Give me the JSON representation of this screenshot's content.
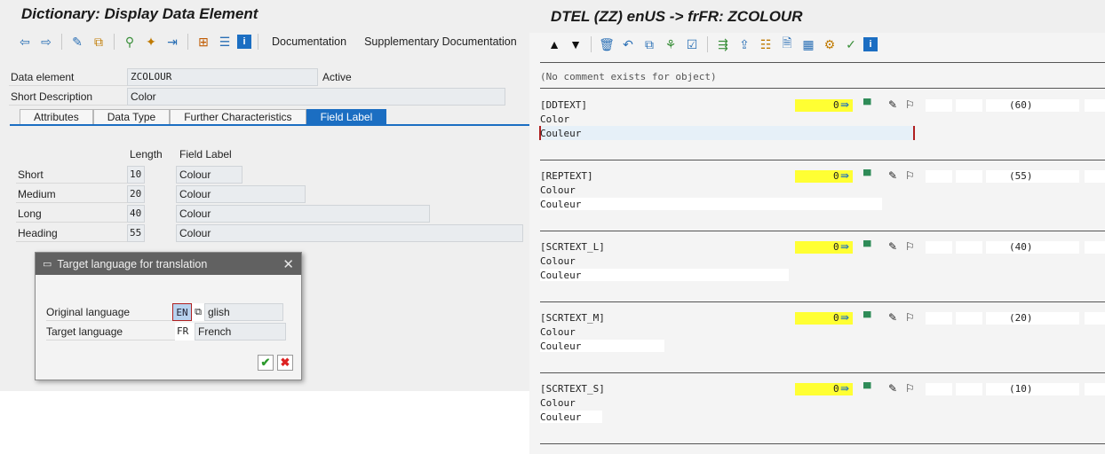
{
  "left_window": {
    "title": "Dictionary: Display Data Element",
    "toolbar": {
      "documentation": "Documentation",
      "supplementary": "Supplementary Documentation"
    },
    "data_element_label": "Data element",
    "data_element_value": "ZCOLOUR",
    "status": "Active",
    "short_desc_label": "Short Description",
    "short_desc_value": "Color",
    "tabs": [
      "Attributes",
      "Data Type",
      "Further Characteristics",
      "Field Label"
    ],
    "field_label_header": {
      "length": "Length",
      "label": "Field Label"
    },
    "rows": [
      {
        "name": "Short",
        "length": "10",
        "label": "Colour"
      },
      {
        "name": "Medium",
        "length": "20",
        "label": "Colour"
      },
      {
        "name": "Long",
        "length": "40",
        "label": "Colour"
      },
      {
        "name": "Heading",
        "length": "55",
        "label": "Colour"
      }
    ]
  },
  "dialog": {
    "title": "Target language for translation",
    "original_label": "Original language",
    "original_code": "EN",
    "original_name": "glish",
    "target_label": "Target language",
    "target_code": "FR",
    "target_name": "French"
  },
  "right_window": {
    "title": "DTEL (ZZ) enUS -> frFR: ZCOLOUR",
    "comment": "(No comment exists for object)",
    "blocks": [
      {
        "key": "[DDTEXT]",
        "count": "0",
        "length": "(60)",
        "source": "Color",
        "target": "Couleur"
      },
      {
        "key": "[REPTEXT]",
        "count": "0",
        "length": "(55)",
        "source": "Colour",
        "target": "Couleur"
      },
      {
        "key": "[SCRTEXT_L]",
        "count": "0",
        "length": "(40)",
        "source": "Colour",
        "target": "Couleur"
      },
      {
        "key": "[SCRTEXT_M]",
        "count": "0",
        "length": "(20)",
        "source": "Colour",
        "target": "Couleur"
      },
      {
        "key": "[SCRTEXT_S]",
        "count": "0",
        "length": "(10)",
        "source": "Colour",
        "target": "Couleur"
      }
    ]
  }
}
